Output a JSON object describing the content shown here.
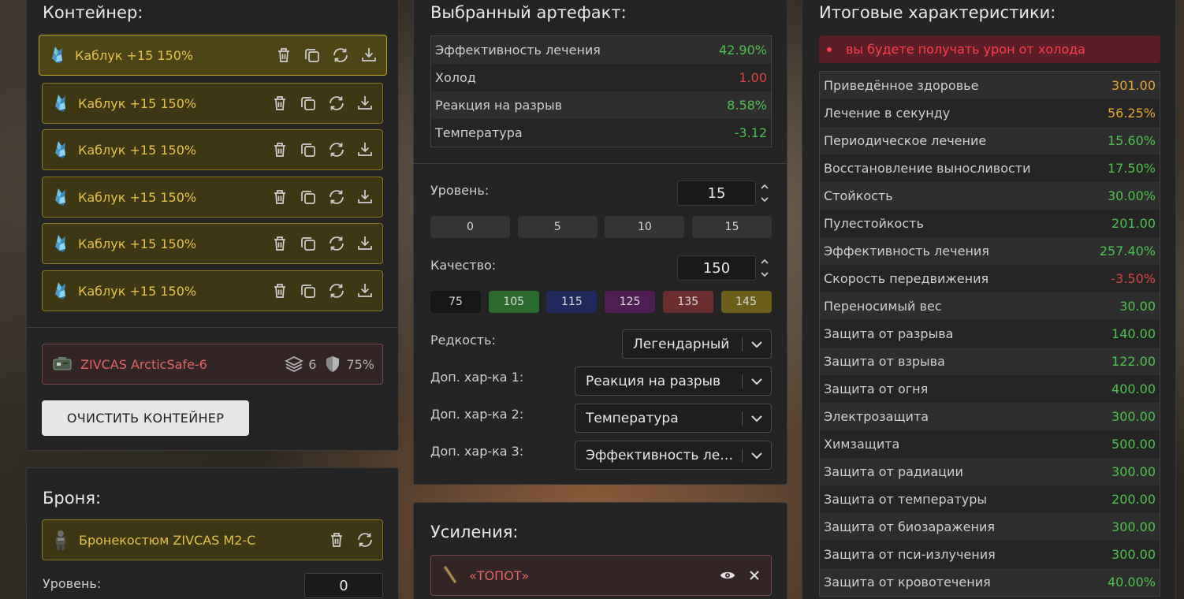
{
  "colors": {
    "gold": "#e6c14a",
    "red_text": "#e06565",
    "green": "#4cc24c",
    "red": "#d84545",
    "orange": "#e8a33a",
    "warning_bg": "#5a1f26"
  },
  "container": {
    "title": "Контейнер:",
    "slots": [
      {
        "label": "Каблук +15 150%",
        "icon": "crystal-artifact-icon"
      },
      {
        "label": "Каблук +15 150%",
        "icon": "crystal-artifact-icon"
      },
      {
        "label": "Каблук +15 150%",
        "icon": "crystal-artifact-icon"
      },
      {
        "label": "Каблук +15 150%",
        "icon": "crystal-artifact-icon"
      },
      {
        "label": "Каблук +15 150%",
        "icon": "crystal-artifact-icon"
      },
      {
        "label": "Каблук +15 150%",
        "icon": "crystal-artifact-icon"
      }
    ],
    "case": {
      "name": "ZIVCAS ArcticSafe-6",
      "capacity": "6",
      "protection": "75%"
    },
    "clear_button": "ОЧИСТИТЬ КОНТЕЙНЕР"
  },
  "armor": {
    "title": "Броня:",
    "name": "Бронекостюм ZIVCAS M2-C",
    "level_label": "Уровень:",
    "level_value": "0"
  },
  "artifact": {
    "title": "Выбранный артефакт:",
    "stats": [
      {
        "k": "Эффективность лечения",
        "v": "42.90%",
        "c": "green"
      },
      {
        "k": "Холод",
        "v": "1.00",
        "c": "red"
      },
      {
        "k": "Реакция на разрыв",
        "v": "8.58%",
        "c": "green"
      },
      {
        "k": "Температура",
        "v": "-3.12",
        "c": "green"
      }
    ],
    "level_label": "Уровень:",
    "level_value": "15",
    "level_presets": [
      "0",
      "5",
      "10",
      "15"
    ],
    "quality_label": "Качество:",
    "quality_value": "150",
    "quality_presets": [
      {
        "v": "75",
        "bg": "#161616"
      },
      {
        "v": "105",
        "bg": "#2b6b2e"
      },
      {
        "v": "115",
        "bg": "#212a5e"
      },
      {
        "v": "125",
        "bg": "#4f1e55"
      },
      {
        "v": "135",
        "bg": "#6b2e2e"
      },
      {
        "v": "145",
        "bg": "#6b5f1a"
      }
    ],
    "rarity_label": "Редкость:",
    "rarity_value": "Легендарный",
    "extra1_label": "Доп. хар-ка 1:",
    "extra1_value": "Реакция на разрыв",
    "extra2_label": "Доп. хар-ка 2:",
    "extra2_value": "Температура",
    "extra3_label": "Доп. хар-ка 3:",
    "extra3_value": "Эффективность лечения"
  },
  "boosts": {
    "title": "Усиления:",
    "item": "«ТОПОТ»"
  },
  "totals": {
    "title": "Итоговые характеристики:",
    "warning": "вы будете получать урон от холода",
    "rows": [
      {
        "k": "Приведённое здоровье",
        "v": "301.00",
        "c": "orange"
      },
      {
        "k": "Лечение в секунду",
        "v": "56.25%",
        "c": "orange"
      },
      {
        "k": "Периодическое лечение",
        "v": "15.60%",
        "c": "green"
      },
      {
        "k": "Восстановление выносливости",
        "v": "17.50%",
        "c": "green"
      },
      {
        "k": "Стойкость",
        "v": "30.00%",
        "c": "green"
      },
      {
        "k": "Пулестойкость",
        "v": "201.00",
        "c": "green"
      },
      {
        "k": "Эффективность лечения",
        "v": "257.40%",
        "c": "green"
      },
      {
        "k": "Скорость передвижения",
        "v": "-3.50%",
        "c": "red"
      },
      {
        "k": "Переносимый вес",
        "v": "30.00",
        "c": "green"
      },
      {
        "k": "Защита от разрыва",
        "v": "140.00",
        "c": "green"
      },
      {
        "k": "Защита от взрыва",
        "v": "122.00",
        "c": "green"
      },
      {
        "k": "Защита от огня",
        "v": "400.00",
        "c": "green"
      },
      {
        "k": "Электрозащита",
        "v": "300.00",
        "c": "green"
      },
      {
        "k": "Химзащита",
        "v": "500.00",
        "c": "green"
      },
      {
        "k": "Защита от радиации",
        "v": "300.00",
        "c": "green"
      },
      {
        "k": "Защита от температуры",
        "v": "200.00",
        "c": "green"
      },
      {
        "k": "Защита от биозаражения",
        "v": "300.00",
        "c": "green"
      },
      {
        "k": "Защита от пси-излучения",
        "v": "300.00",
        "c": "green"
      },
      {
        "k": "Защита от кровотечения",
        "v": "40.00%",
        "c": "green"
      }
    ]
  }
}
